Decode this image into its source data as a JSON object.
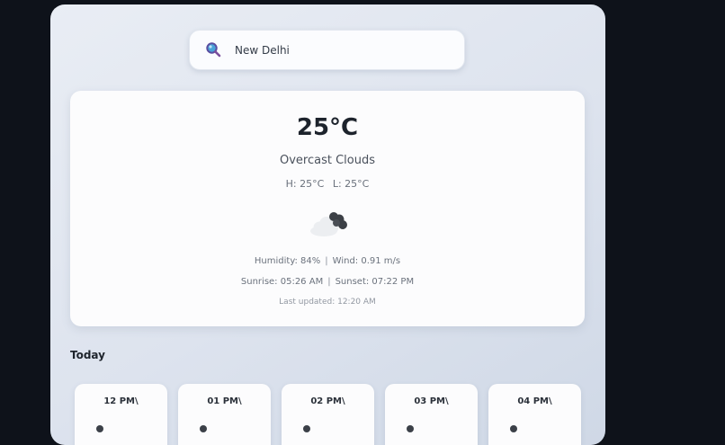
{
  "search": {
    "value": "New Delhi",
    "icon": "search-icon"
  },
  "current": {
    "temperature": "25°C",
    "condition": "Overcast Clouds",
    "high": "H: 25°C",
    "low": "L: 25°C",
    "icon": "overcast-clouds-icon",
    "humidity": "Humidity: 84%",
    "wind": "Wind: 0.91 m/s",
    "sunrise": "Sunrise: 05:26 AM",
    "sunset": "Sunset: 07:22 PM",
    "separator": "|",
    "last_updated": "Last updated: 12:20 AM"
  },
  "today": {
    "title": "Today",
    "hours": [
      {
        "time": "12 PM\\"
      },
      {
        "time": "01 PM\\"
      },
      {
        "time": "02 PM\\"
      },
      {
        "time": "03 PM\\"
      },
      {
        "time": "04 PM\\"
      }
    ]
  },
  "colors": {
    "page_background": "#0e121a",
    "panel_background": "#e9edf4",
    "card_background": "#fcfcfd",
    "text_primary": "#1d232c"
  }
}
